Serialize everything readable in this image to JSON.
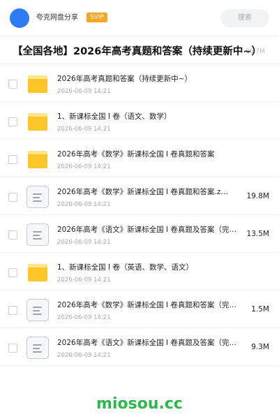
{
  "header": {
    "brand": "夸克网盘分享",
    "badge": "SVIP",
    "search_placeholder": "搜索"
  },
  "page": {
    "title": "【全国各地】2026年高考真题和答案（持续更新中~）",
    "title_faded": "36.7M"
  },
  "files": [
    {
      "type": "folder",
      "name": "2026年高考真题和答案（持续更新中~）",
      "date": "2026-06-09 14:21",
      "size": ""
    },
    {
      "type": "folder",
      "name": "1、新课标全国 I 卷（语文、数学）",
      "date": "2026-06-09 14:21",
      "size": ""
    },
    {
      "type": "folder",
      "name": "2026年高考《数学》新课标全国 I 卷真题和答案",
      "date": "2026-06-09 14:21",
      "size": ""
    },
    {
      "type": "doc",
      "name": "2026年高考《数学》新课标全国 I 卷真题和答案.z…",
      "date": "2026-06-09 14:21",
      "size": "19.8M"
    },
    {
      "type": "doc",
      "name": "2026年高考《语文》新课标全国 I 卷真题及答案（完…",
      "date": "2026-06-09 14:21",
      "size": "13.5M"
    },
    {
      "type": "folder",
      "name": "1、新课标全国 I 卷（英语、数学、语文）",
      "date": "2026-06-09 14:21",
      "size": ""
    },
    {
      "type": "doc",
      "name": "2026年高考《数学》新课标全国 I 卷真题和答案（完…",
      "date": "2026-06-09 14:21",
      "size": "1.5M"
    },
    {
      "type": "doc",
      "name": "2026年高考《语文》新课标全国 I 卷真题及答案（完…",
      "date": "2026-06-09 14:21",
      "size": "9.3M"
    }
  ],
  "watermark": "miosou.cc",
  "colors": {
    "accent_blue": "#2f7bf5",
    "svip_orange": "#f5a623",
    "folder_yellow": "#ffc629",
    "watermark_green": "#2db84d"
  },
  "icons": {
    "folder": "folder-icon",
    "doc": "document-icon"
  }
}
